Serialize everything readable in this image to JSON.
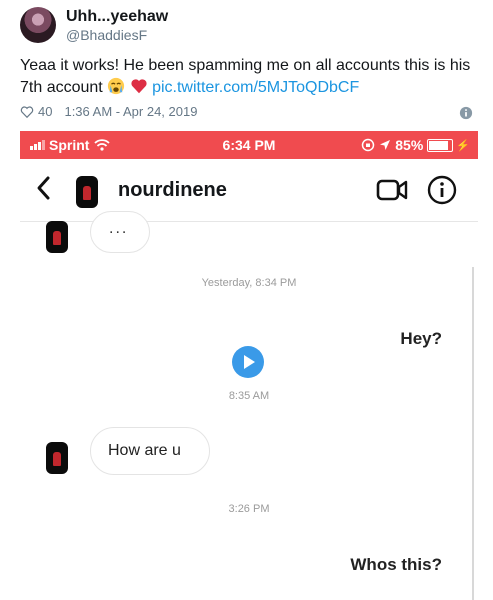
{
  "tweet": {
    "display_name": "Uhh...yeehaw",
    "handle": "@BhaddiesF",
    "text": "Yeaa it works! He been spamming me on all accounts this is his 7th account ",
    "emojis": [
      "crying-face-emoji",
      "red-heart-emoji"
    ],
    "link": "pic.twitter.com/5MJToQDbCF",
    "likes": "40",
    "timestamp": "1:36 AM - Apr 24, 2019",
    "colors": {
      "link": "#1b95e0",
      "meta": "#657786"
    }
  },
  "screenshot": {
    "status_bar": {
      "carrier": "Sprint",
      "time": "6:34 PM",
      "battery": "85%",
      "color": "#f04b4f"
    },
    "chat": {
      "contact_name": "nourdinene",
      "messages": [
        {
          "type": "incoming",
          "text": "..."
        },
        {
          "type": "timestamp",
          "text": "Yesterday, 8:34 PM"
        },
        {
          "type": "outgoing",
          "text": "Hey?"
        },
        {
          "type": "voice",
          "icon": "play-icon"
        },
        {
          "type": "timestamp",
          "text": "8:35 AM"
        },
        {
          "type": "incoming",
          "text": "How are u"
        },
        {
          "type": "timestamp",
          "text": "3:26 PM"
        },
        {
          "type": "outgoing",
          "text": "Whos this?"
        }
      ],
      "accent_color": "#3a9ae8"
    }
  }
}
